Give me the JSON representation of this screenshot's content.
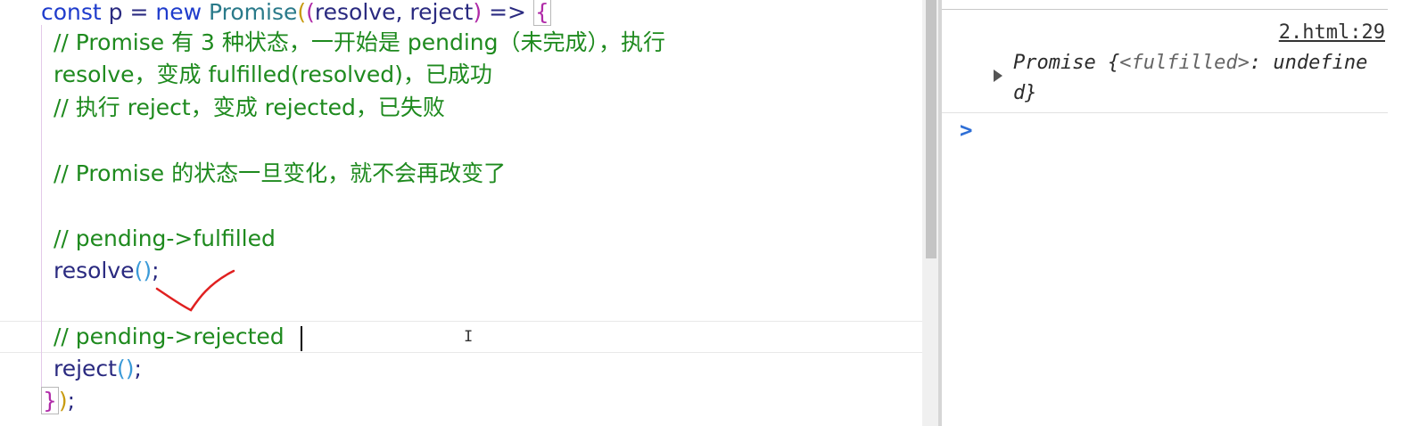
{
  "editor": {
    "line1": {
      "kw_const": "const",
      "var": " p = ",
      "kw_new": "new",
      "cls": " Promise",
      "open_paren": "(",
      "open_paren2": "(",
      "params": "resolve, reject",
      "close_paren": ")",
      "arrow": " => ",
      "brace": "{"
    },
    "comment1": "// Promise 有 3 种状态，一开始是 pending（未完成），执行",
    "comment2": "resolve，变成 fulfilled(resolved)，已成功",
    "comment3": "// 执行 reject，变成 rejected，已失败",
    "comment4": "// Promise 的状态一旦变化，就不会再改变了",
    "comment5": "// pending->fulfilled",
    "call_resolve": {
      "name": "resolve",
      "parens": "()",
      "semi": ";"
    },
    "comment6": "// pending->rejected",
    "call_reject": {
      "name": "reject",
      "parens": "()",
      "semi": ";"
    },
    "closing": {
      "brace": "}",
      "paren": ")",
      "semi": ";"
    }
  },
  "console": {
    "source_link": "2.html:29",
    "log": {
      "prefix": "Promise {",
      "state": "<fulfilled>",
      "suffix": ": undefined}"
    },
    "prompt_icon": "chevron-right-icon",
    "prompt_glyph": ">"
  },
  "colors": {
    "comment": "#1e8a1e",
    "keyword": "#1f3ccc",
    "identifier": "#2a2a80",
    "class_name": "#2a7a8a",
    "prompt": "#2f6fd6",
    "annotation": "#e02020"
  }
}
